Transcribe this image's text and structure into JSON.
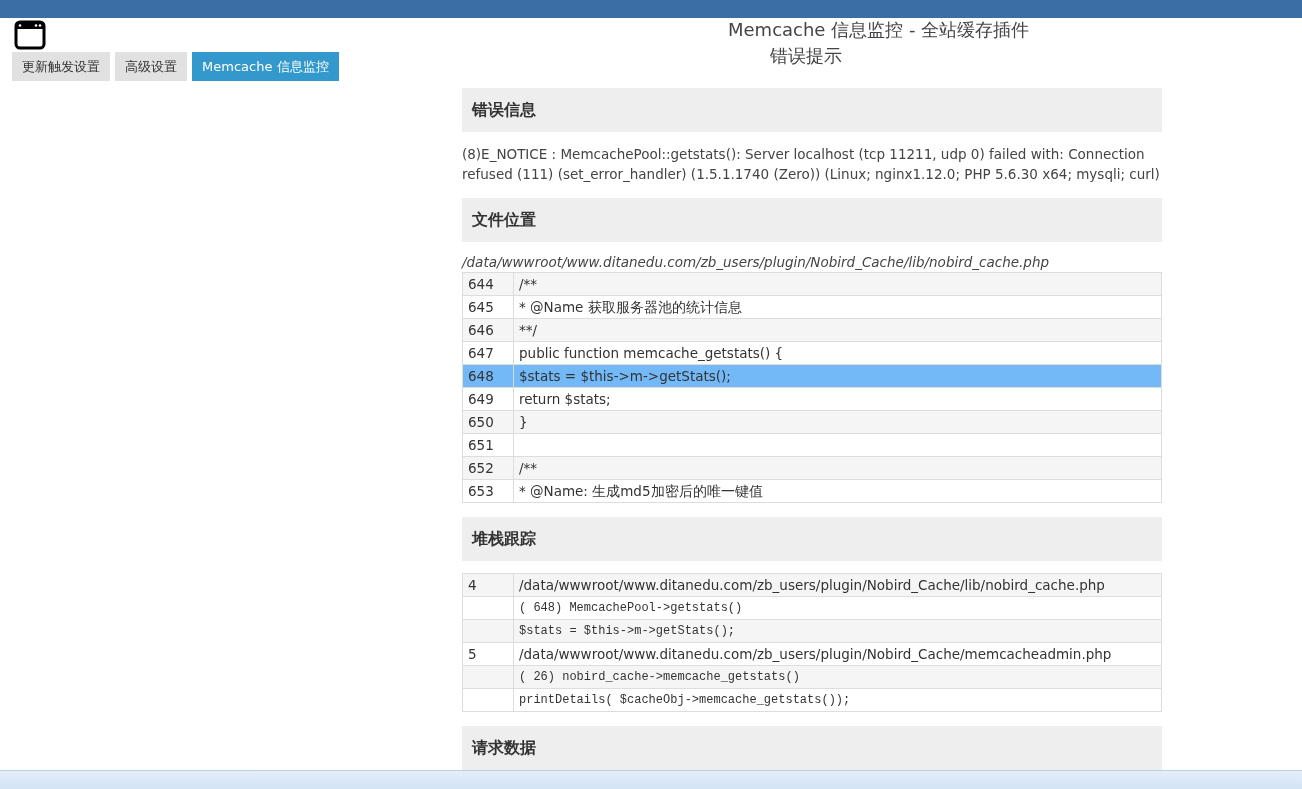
{
  "tabs": [
    {
      "label": "更新触发设置",
      "selected": false
    },
    {
      "label": "高级设置",
      "selected": false
    },
    {
      "label": "Memcache 信息监控",
      "selected": true
    }
  ],
  "title": "Memcache 信息监控 - 全站缓存插件",
  "subtitle": "错误提示",
  "sections": [
    {
      "kind": "message",
      "heading": "错误信息",
      "text": "(8)E_NOTICE : MemcachePool::getstats(): Server localhost (tcp 11211, udp 0) failed with: Connection refused (111) (set_error_handler) (1.5.1.1740 (Zero)) (Linux; nginx1.12.0; PHP 5.6.30 x64; mysqli; curl)"
    },
    {
      "kind": "source",
      "heading": "文件位置",
      "path": "/data/wwwroot/www.ditanedu.com/zb_users/plugin/Nobird_Cache/lib/nobird_cache.php",
      "lines": [
        {
          "number": "644",
          "code": "/**",
          "selected": false
        },
        {
          "number": "645",
          "code": "* @Name 获取服务器池的统计信息",
          "selected": false
        },
        {
          "number": "646",
          "code": "**/",
          "selected": false
        },
        {
          "number": "647",
          "code": "public function memcache_getstats() {",
          "selected": false
        },
        {
          "number": "648",
          "code": "$stats = $this->m->getStats();",
          "selected": true
        },
        {
          "number": "649",
          "code": "return $stats;",
          "selected": false
        },
        {
          "number": "650",
          "code": "}",
          "selected": false
        },
        {
          "number": "651",
          "selected": false
        },
        {
          "number": "652",
          "code": "/**",
          "selected": false
        },
        {
          "number": "653",
          "code": "* @Name: 生成md5加密后的唯一键值",
          "selected": false
        }
      ]
    },
    {
      "kind": "trace",
      "heading": "堆栈跟踪",
      "rows": [
        {
          "kind": "file",
          "index": "4",
          "text": "/data/wwwroot/www.ditanedu.com/zb_users/plugin/Nobird_Cache/lib/nobird_cache.php"
        },
        {
          "kind": "code",
          "text": "( 648) MemcachePool->getstats()"
        },
        {
          "kind": "code",
          "text": "$stats = $this->m->getStats();"
        },
        {
          "kind": "file",
          "index": "5",
          "text": "/data/wwwroot/www.ditanedu.com/zb_users/plugin/Nobird_Cache/memcacheadmin.php"
        },
        {
          "kind": "code",
          "text": "( 26) nobird_cache->memcache_getstats()"
        },
        {
          "kind": "code",
          "text": "printDetails( $cacheObj->memcache_getstats());"
        }
      ]
    },
    {
      "kind": "heading",
      "heading": "请求数据"
    }
  ]
}
